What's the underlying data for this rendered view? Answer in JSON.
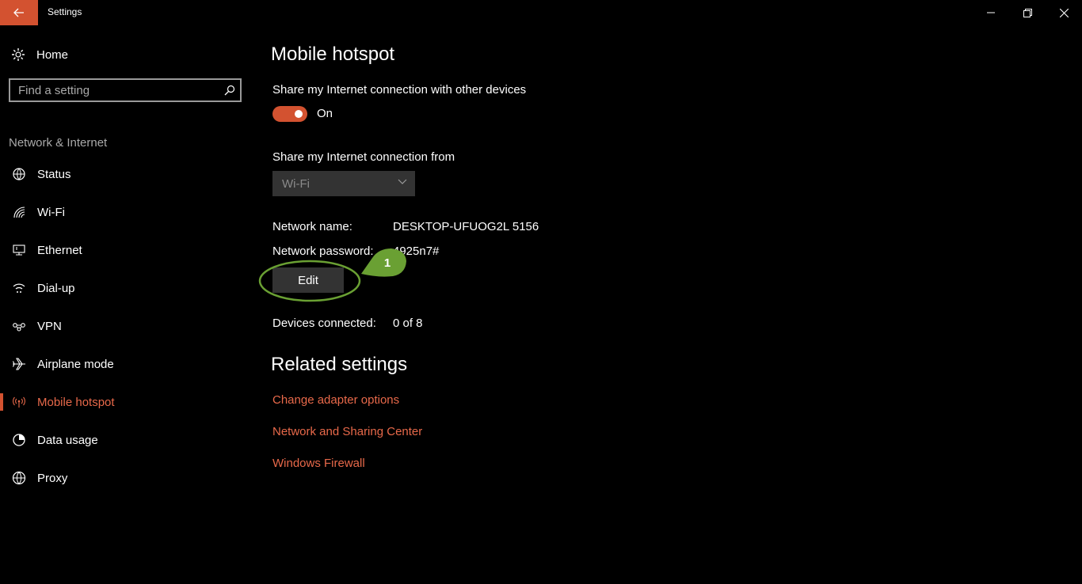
{
  "window": {
    "title": "Settings",
    "accent": "#d35230",
    "back_icon": "back-arrow-icon",
    "controls": [
      "minimize-icon",
      "restore-icon",
      "close-icon"
    ]
  },
  "sidebar": {
    "home_label": "Home",
    "search_placeholder": "Find a setting",
    "section_label": "Network & Internet",
    "items": [
      {
        "label": "Status",
        "icon": "globe-status-icon"
      },
      {
        "label": "Wi-Fi",
        "icon": "wifi-icon"
      },
      {
        "label": "Ethernet",
        "icon": "ethernet-icon"
      },
      {
        "label": "Dial-up",
        "icon": "dialup-icon"
      },
      {
        "label": "VPN",
        "icon": "vpn-icon"
      },
      {
        "label": "Airplane mode",
        "icon": "airplane-icon"
      },
      {
        "label": "Mobile hotspot",
        "icon": "hotspot-icon",
        "active": true
      },
      {
        "label": "Data usage",
        "icon": "data-usage-icon"
      },
      {
        "label": "Proxy",
        "icon": "globe-icon"
      }
    ]
  },
  "main": {
    "title": "Mobile hotspot",
    "share_label": "Share my Internet connection with other devices",
    "toggle_state": "On",
    "share_from_label": "Share my Internet connection from",
    "share_from_value": "Wi-Fi",
    "network_name_label": "Network name:",
    "network_name_value": "DESKTOP-UFUOG2L 5156",
    "network_password_label": "Network password:",
    "network_password_value": "4925n7#",
    "edit_button": "Edit",
    "devices_label": "Devices connected:",
    "devices_value": "0 of 8",
    "related_title": "Related settings",
    "related_links": [
      "Change adapter options",
      "Network and Sharing Center",
      "Windows Firewall"
    ],
    "link_color": "#e8694a"
  },
  "annotation": {
    "marker_label": "1",
    "color": "#6aa033"
  }
}
